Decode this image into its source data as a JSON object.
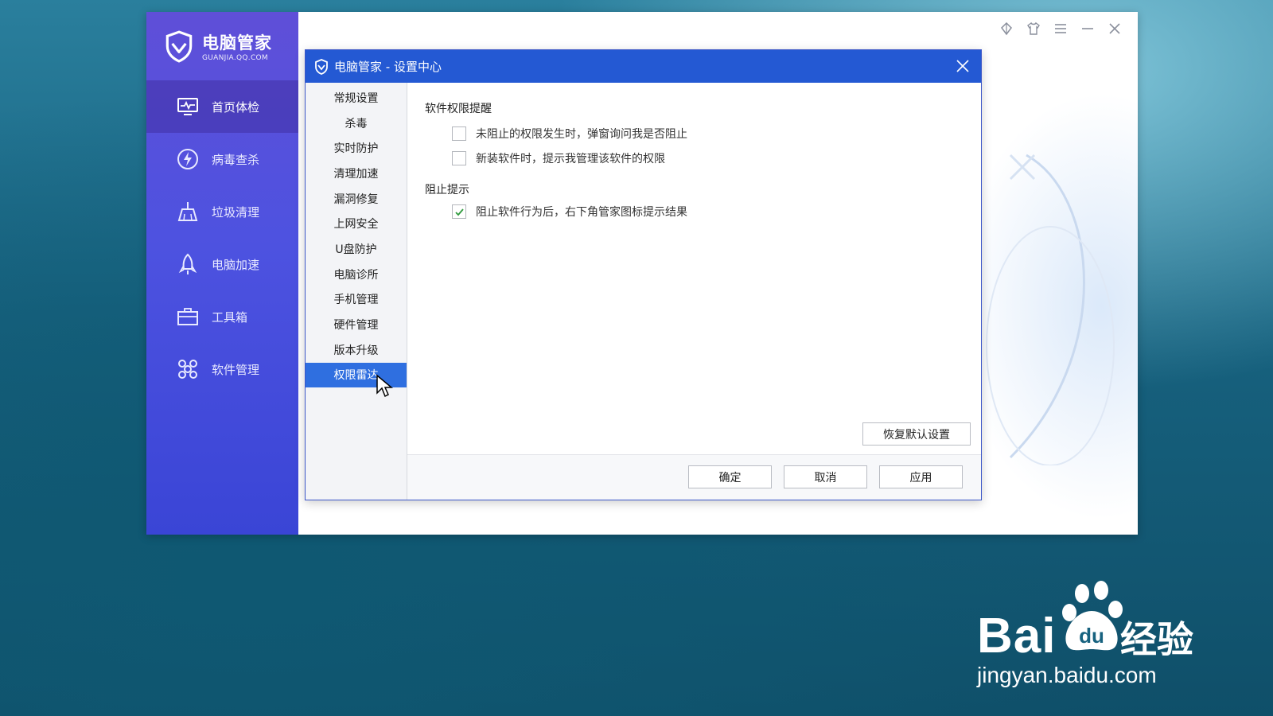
{
  "app": {
    "logo_title": "电脑管家",
    "logo_sub": "GUANJIA.QQ.COM",
    "nav": [
      {
        "label": "首页体检",
        "icon": "monitor-icon",
        "active": true
      },
      {
        "label": "病毒查杀",
        "icon": "lightning-shield-icon"
      },
      {
        "label": "垃圾清理",
        "icon": "broom-icon"
      },
      {
        "label": "电脑加速",
        "icon": "rocket-icon"
      },
      {
        "label": "工具箱",
        "icon": "toolbox-icon"
      },
      {
        "label": "软件管理",
        "icon": "apps-icon"
      }
    ],
    "title_controls": [
      "pin-icon",
      "skin-icon",
      "menu-icon",
      "minimize-icon",
      "close-icon"
    ]
  },
  "dialog": {
    "title": "电脑管家 - 设置中心",
    "nav": [
      "常规设置",
      "杀毒",
      "实时防护",
      "清理加速",
      "漏洞修复",
      "上网安全",
      "U盘防护",
      "电脑诊所",
      "手机管理",
      "硬件管理",
      "版本升级",
      "权限雷达"
    ],
    "active_nav": "权限雷达",
    "sections": [
      {
        "title": "软件权限提醒",
        "options": [
          {
            "label": "未阻止的权限发生时，弹窗询问我是否阻止",
            "checked": false
          },
          {
            "label": "新装软件时，提示我管理该软件的权限",
            "checked": false
          }
        ]
      },
      {
        "title": "阻止提示",
        "options": [
          {
            "label": "阻止软件行为后，右下角管家图标提示结果",
            "checked": true
          }
        ]
      }
    ],
    "restore_button": "恢复默认设置",
    "ok_button": "确定",
    "cancel_button": "取消",
    "apply_button": "应用"
  },
  "watermark": {
    "brand": "Bai",
    "brand_cn": "经验",
    "url": "jingyan.baidu.com"
  },
  "colors": {
    "dialog_titlebar": "#2459d3",
    "active_nav": "#2f6fe0",
    "sidebar_top": "#5f4fd8",
    "sidebar_bottom": "#3a45d6"
  }
}
